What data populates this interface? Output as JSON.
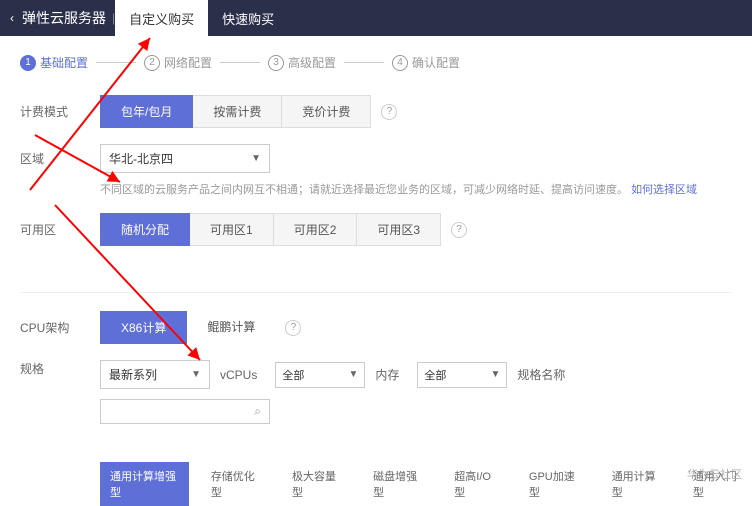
{
  "header": {
    "title": "弹性云服务器",
    "tabs": [
      "自定义购买",
      "快速购买"
    ],
    "active_tab": 0
  },
  "steps": [
    {
      "num": "1",
      "label": "基础配置"
    },
    {
      "num": "2",
      "label": "网络配置"
    },
    {
      "num": "3",
      "label": "高级配置"
    },
    {
      "num": "4",
      "label": "确认配置"
    }
  ],
  "billing": {
    "label": "计费模式",
    "options": [
      "包年/包月",
      "按需计费",
      "竞价计费"
    ]
  },
  "region": {
    "label": "区域",
    "selected": "华北-北京四",
    "hint_prefix": "不同区域的云服务产品之间内网互不相通；请就近选择最近您业务的区域，可减少网络时延、提高访问速度。",
    "hint_link": "如何选择区域"
  },
  "az": {
    "label": "可用区",
    "options": [
      "随机分配",
      "可用区1",
      "可用区2",
      "可用区3"
    ]
  },
  "cpu": {
    "label": "CPU架构",
    "options": [
      "X86计算",
      "鲲鹏计算"
    ]
  },
  "spec": {
    "label": "规格",
    "series_label": "最新系列",
    "vcpu_label": "vCPUs",
    "vcpu_value": "全部",
    "mem_label": "内存",
    "mem_value": "全部",
    "name_label": "规格名称"
  },
  "bottom_tabs": [
    "通用计算增强型",
    "存储优化型",
    "极大容量型",
    "磁盘增强型",
    "超高I/O型",
    "GPU加速型",
    "通用计算型",
    "通用入门型"
  ],
  "watermark": "华为云社区"
}
